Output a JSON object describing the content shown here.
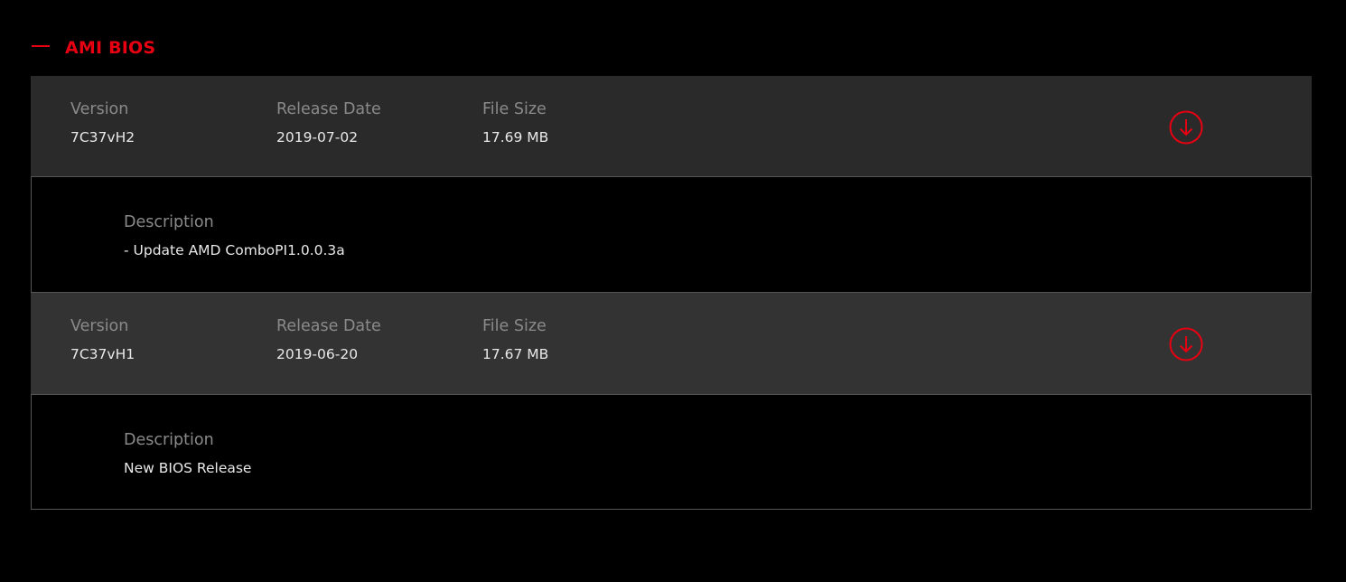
{
  "section": {
    "title": "AMI BIOS",
    "collapse_icon": "minus-icon",
    "accent_color": "#e60012"
  },
  "entries": [
    {
      "version_label": "Version",
      "version": "7C37vH2",
      "date_label": "Release Date",
      "date": "2019-07-02",
      "size_label": "File Size",
      "size": "17.69 MB",
      "download_icon": "download-arrow-icon",
      "description_label": "Description",
      "description": "- Update AMD ComboPI1.0.0.3a"
    },
    {
      "version_label": "Version",
      "version": "7C37vH1",
      "date_label": "Release Date",
      "date": "2019-06-20",
      "size_label": "File Size",
      "size": "17.67 MB",
      "download_icon": "download-arrow-icon",
      "description_label": "Description",
      "description": "New BIOS Release"
    }
  ]
}
